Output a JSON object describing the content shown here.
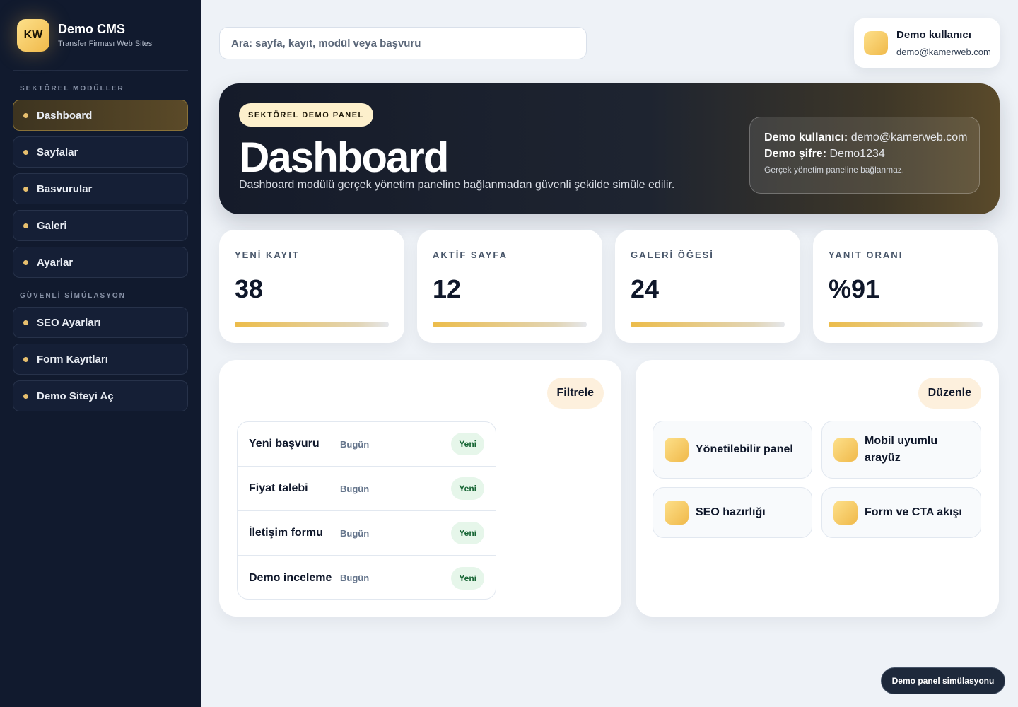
{
  "brand": {
    "logo": "KW",
    "title": "Demo CMS",
    "subtitle": "Transfer Firması Web Sitesi"
  },
  "sidebar": {
    "section1": "SEKTÖREL MODÜLLER",
    "items1": [
      {
        "label": "Dashboard"
      },
      {
        "label": "Sayfalar"
      },
      {
        "label": "Basvurular"
      },
      {
        "label": "Galeri"
      },
      {
        "label": "Ayarlar"
      }
    ],
    "section2": "GÜVENLİ SİMÜLASYON",
    "items2": [
      {
        "label": "SEO Ayarları"
      },
      {
        "label": "Form Kayıtları"
      },
      {
        "label": "Demo Siteyi Aç"
      }
    ]
  },
  "search": {
    "placeholder": "Ara: sayfa, kayıt, modül veya başvuru"
  },
  "user": {
    "name": "Demo kullanıcı",
    "email": "demo@kamerweb.com"
  },
  "hero": {
    "badge": "SEKTÖREL DEMO PANEL",
    "title": "Dashboard",
    "description": "Dashboard modülü gerçek yönetim paneline bağlanmadan güvenli şekilde simüle edilir.",
    "info_user_label": "Demo kullanıcı:",
    "info_user_value": "demo@kamerweb.com",
    "info_pass_label": "Demo şifre:",
    "info_pass_value": "Demo1234",
    "info_note": "Gerçek yönetim paneline bağlanmaz."
  },
  "stats": [
    {
      "label": "YENİ KAYIT",
      "value": "38"
    },
    {
      "label": "AKTİF SAYFA",
      "value": "12"
    },
    {
      "label": "GALERİ ÖĞESİ",
      "value": "24"
    },
    {
      "label": "YANIT ORANI",
      "value": "%91"
    }
  ],
  "records": {
    "filter_label": "Filtrele",
    "rows": [
      {
        "name": "Yeni başvuru",
        "date": "Bugün",
        "status": "Yeni"
      },
      {
        "name": "Fiyat talebi",
        "date": "Bugün",
        "status": "Yeni"
      },
      {
        "name": "İletişim formu",
        "date": "Bugün",
        "status": "Yeni"
      },
      {
        "name": "Demo inceleme",
        "date": "Bugün",
        "status": "Yeni"
      }
    ]
  },
  "features": {
    "edit_label": "Düzenle",
    "items": [
      {
        "label": "Yönetilebilir panel"
      },
      {
        "label": "Mobil uyumlu arayüz"
      },
      {
        "label": "SEO hazırlığı"
      },
      {
        "label": "Form ve CTA akışı"
      }
    ]
  },
  "toast": "Demo panel simülasyonu",
  "colors": {
    "accent": "#f0b94a",
    "sidebar_bg": "#111a2e",
    "page_bg": "#eef2f7",
    "badge_green": "#e6f6ea"
  }
}
